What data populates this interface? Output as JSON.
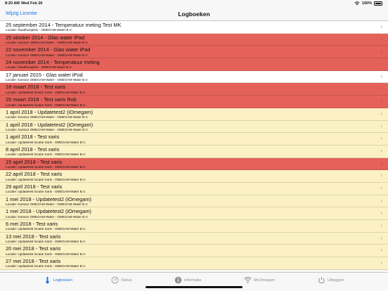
{
  "status": {
    "time": "8:20 AM",
    "date": "Wed Feb 26",
    "battery": "100%"
  },
  "nav": {
    "left_button": "Wijzig Licentie",
    "title": "Logboeken"
  },
  "rows": [
    {
      "title": "25 september 2014 - Temperatuur meting Test MK",
      "sub": "Locatie: Raadhuisplein - OMEGAM-Water B.V.",
      "color": "white"
    },
    {
      "title": "25 oktober 2014 - Glas water iPad",
      "sub": "Locatie: Kantoor OMEGAM-Water - OMEGAM-Water B.V.",
      "color": "red"
    },
    {
      "title": "22 november 2014 - Glas water iPad",
      "sub": "Locatie: Kantoor OMEGAM-Water - OMEGAM-Water B.V.",
      "color": "red"
    },
    {
      "title": "24 november 2014 - Temperatuur meting",
      "sub": "Locatie: Raadhuisplein - OMEGAM-Water B.V.",
      "color": "red"
    },
    {
      "title": "17 januari 2015 - Glas water iPod",
      "sub": "Locatie: Kantoor OMEGAM-Water - OMEGAM-Water B.V.",
      "color": "white"
    },
    {
      "title": "18 maart 2018 - Test xaris",
      "sub": "Locatie: Updatetest locatie Xaris - OMEGAM-Water B.V.",
      "color": "red"
    },
    {
      "title": "25 maart 2018 - Test xaris Rob",
      "sub": "Locatie: Updatetest locatie Xaris - OMEGAM-Water B.V.",
      "color": "red"
    },
    {
      "title": "1 april 2018 - Updatetest2 (iOmegam)",
      "sub": "Locatie: Kantoor OMEGAM-Water - OMEGAM-Water B.V.",
      "color": "yellow"
    },
    {
      "title": "1 april 2018 - Updatetest2 (iOmegam)",
      "sub": "Locatie: Kantoor OMEGAM-Water - OMEGAM-Water B.V.",
      "color": "yellow"
    },
    {
      "title": "1 april 2018 - Test xaris",
      "sub": "Locatie: Updatetest locatie Xaris - OMEGAM-Water B.V.",
      "color": "yellow"
    },
    {
      "title": "8 april 2018 - Test xaris",
      "sub": "Locatie: Updatetest locatie Xaris - OMEGAM-Water B.V.",
      "color": "yellow"
    },
    {
      "title": "15 april 2018 - Test xaris",
      "sub": "Locatie: Updatetest locatie Xaris - OMEGAM-Water B.V.",
      "color": "red"
    },
    {
      "title": "22 april 2018 - Test xaris",
      "sub": "Locatie: Updatetest locatie Xaris - OMEGAM-Water B.V.",
      "color": "yellow"
    },
    {
      "title": "29 april 2018 - Test xaris",
      "sub": "Locatie: Updatetest locatie Xaris - OMEGAM-Water B.V.",
      "color": "yellow"
    },
    {
      "title": "1 mei 2018 - Updatetest2 (iOmegam)",
      "sub": "Locatie: Kantoor OMEGAM-Water - OMEGAM-Water B.V.",
      "color": "yellow"
    },
    {
      "title": "1 mei 2018 - Updatetest2 (iOmegam)",
      "sub": "Locatie: Kantoor OMEGAM-Water - OMEGAM-Water B.V.",
      "color": "yellow"
    },
    {
      "title": "6 mei 2018 - Test xaris",
      "sub": "Locatie: Updatetest locatie Xaris - OMEGAM-Water B.V.",
      "color": "yellow"
    },
    {
      "title": "13 mei 2018 - Test xaris",
      "sub": "Locatie: Updatetest locatie Xaris - OMEGAM-Water B.V.",
      "color": "yellow"
    },
    {
      "title": "20 mei 2018 - Test xaris",
      "sub": "Locatie: Updatetest locatie Xaris - OMEGAM-Water B.V.",
      "color": "yellow"
    },
    {
      "title": "27 mei 2018 - Test xaris",
      "sub": "Locatie: Updatetest locatie Xaris - OMEGAM-Water B.V.",
      "color": "yellow"
    }
  ],
  "tabs": [
    {
      "label": "Logboeken",
      "icon": "thermometer-icon",
      "active": true
    },
    {
      "label": "Status",
      "icon": "gauge-icon",
      "active": false
    },
    {
      "label": "Informatie",
      "icon": "info-icon",
      "active": false
    },
    {
      "label": "MyOmegam",
      "icon": "wifi-icon",
      "active": false
    },
    {
      "label": "Uitloggen",
      "icon": "power-icon",
      "active": false
    }
  ],
  "colors": {
    "accent": "#1a73e8",
    "red_row": "#e4625a",
    "yellow_row": "#fcf1c4"
  }
}
